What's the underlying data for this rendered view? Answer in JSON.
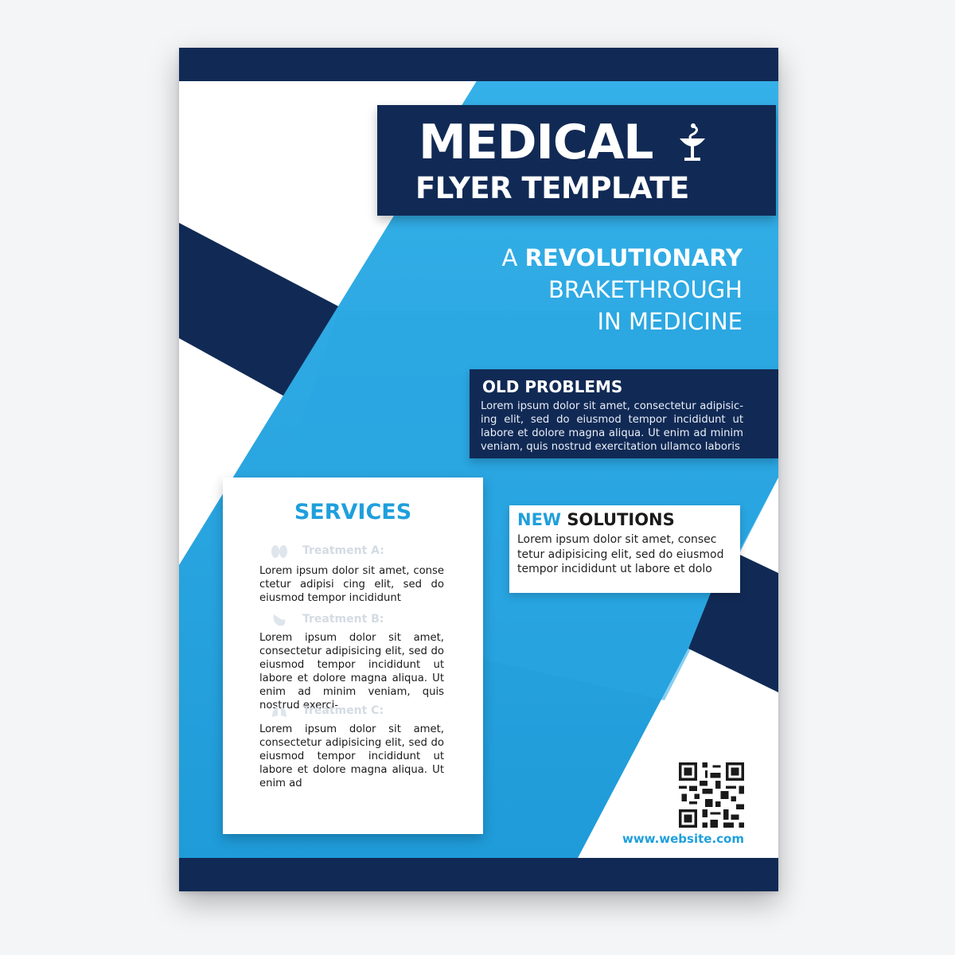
{
  "header": {
    "title_main": "MEDICAL",
    "title_sub": "FLYER TEMPLATE",
    "icon": "caduceus-bowl-icon"
  },
  "tagline": {
    "prefix": "A ",
    "highlight": "REVOLUTIONARY",
    "line2": "BRAKETHROUGH",
    "line3": "IN MEDICINE"
  },
  "old_problems": {
    "heading_bold": "OLD",
    "heading_rest": " PROBLEMS",
    "body": "Lorem ipsum dolor sit amet, consectetur adipisic-ing elit, sed do eiusmod tempor incididunt ut labore et dolore magna aliqua. Ut enim ad minim veniam, quis nostrud exercitation ullamco laboris"
  },
  "new_solutions": {
    "heading_accent": "NEW",
    "heading_rest": " SOLUTIONS",
    "body": "Lorem ipsum dolor sit amet, consec tetur adipisicing elit, sed do eiusmod tempor incididunt ut labore et dolo"
  },
  "services": {
    "title": "SERVICES",
    "items": [
      {
        "label": "Treatment A:",
        "icon": "kidneys-icon",
        "text": "Lorem ipsum dolor sit amet, conse ctetur adipisi cing elit, sed do eiusmod tempor incididunt"
      },
      {
        "label": "Treatment B:",
        "icon": "stomach-icon",
        "text": "Lorem ipsum dolor sit amet, consectetur adipisicing elit, sed do eiusmod tempor incididunt ut labore et dolore magna aliqua. Ut enim ad minim veniam, quis nostrud exerci-"
      },
      {
        "label": "Treatment C:",
        "icon": "lungs-icon",
        "text": "Lorem ipsum dolor sit amet, consectetur adipisicing elit, sed do eiusmod tempor incididunt ut labore et dolore magna aliqua. Ut enim ad"
      }
    ]
  },
  "footer": {
    "website": "www.website.com",
    "qr_icon": "qr-code-icon"
  },
  "colors": {
    "navy": "#112a55",
    "blue": "#1f9fdc",
    "light_blue": "#35b0e8",
    "white": "#ffffff"
  }
}
